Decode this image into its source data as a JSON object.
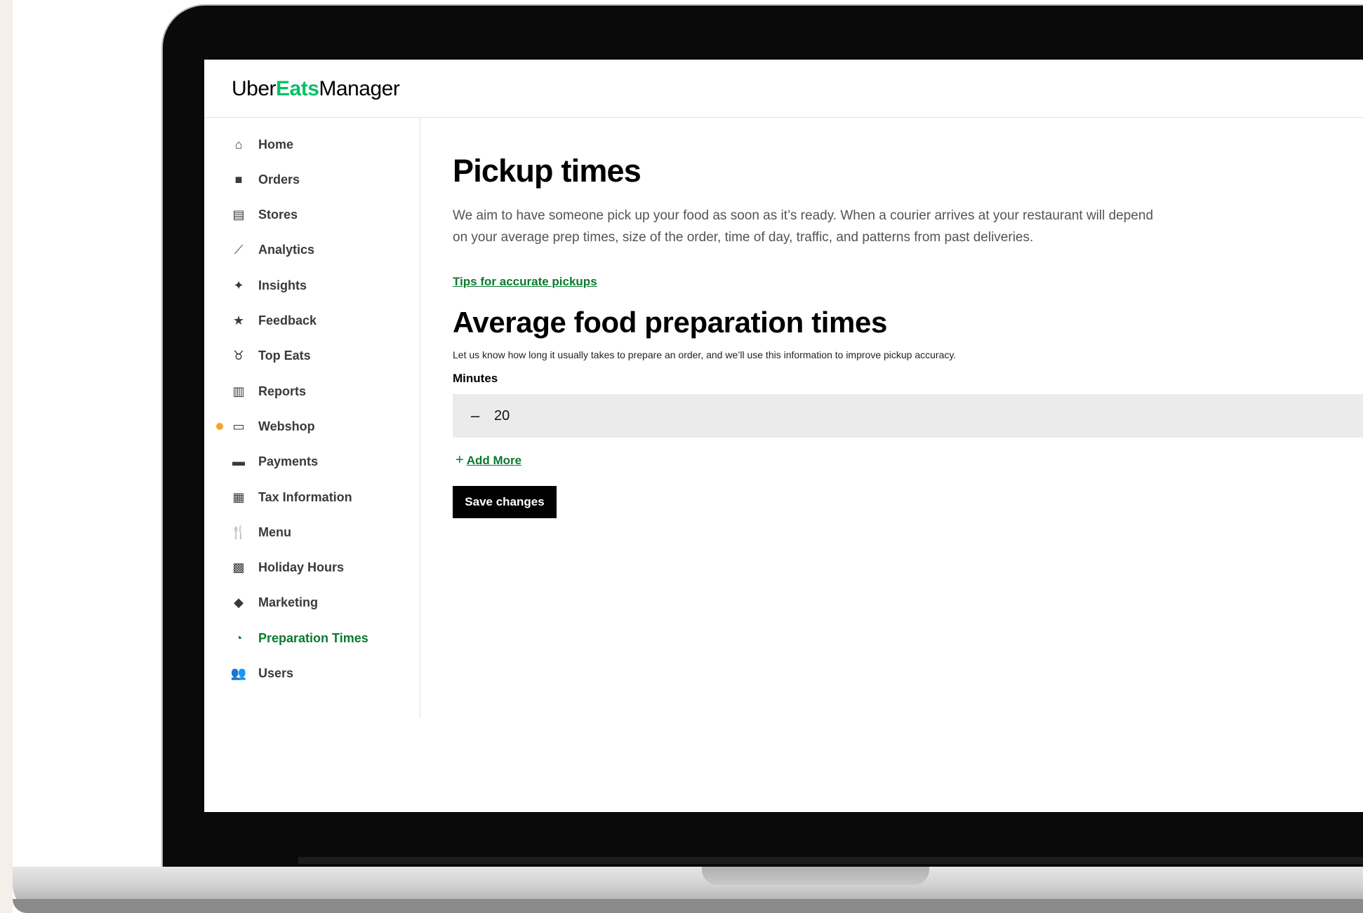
{
  "brand": {
    "part1": "Uber",
    "part2": "Eats",
    "part3": "Manager",
    "accent": "#06c167"
  },
  "sidebar": {
    "items": [
      {
        "label": "Home",
        "icon": "home-icon",
        "glyph": "⌂"
      },
      {
        "label": "Orders",
        "icon": "bag-icon",
        "glyph": "■"
      },
      {
        "label": "Stores",
        "icon": "store-icon",
        "glyph": "▤"
      },
      {
        "label": "Analytics",
        "icon": "chart-icon",
        "glyph": "⟋"
      },
      {
        "label": "Insights",
        "icon": "sparkle-icon",
        "glyph": "✦"
      },
      {
        "label": "Feedback",
        "icon": "star-icon",
        "glyph": "★"
      },
      {
        "label": "Top Eats",
        "icon": "medal-icon",
        "glyph": "♉"
      },
      {
        "label": "Reports",
        "icon": "document-icon",
        "glyph": "▥"
      },
      {
        "label": "Webshop",
        "icon": "laptop-icon",
        "glyph": "▭",
        "badge": true
      },
      {
        "label": "Payments",
        "icon": "card-icon",
        "glyph": "▬"
      },
      {
        "label": "Tax Information",
        "icon": "calculator-icon",
        "glyph": "▦"
      },
      {
        "label": "Menu",
        "icon": "utensils-icon",
        "glyph": "🍴"
      },
      {
        "label": "Holiday Hours",
        "icon": "calendar-icon",
        "glyph": "▩"
      },
      {
        "label": "Marketing",
        "icon": "tag-icon",
        "glyph": "◆"
      },
      {
        "label": "Preparation Times",
        "icon": "timer-icon",
        "glyph": "◔",
        "active": true
      },
      {
        "label": "Users",
        "icon": "users-icon",
        "glyph": "👥"
      }
    ]
  },
  "main": {
    "title": "Pickup times",
    "description": "We aim to have someone pick up your food as soon as it’s ready. When a courier arrives at your restaurant will depend on your average prep times, size of the order, time of day, traffic, and patterns from past deliveries.",
    "tips_link": "Tips for accurate pickups",
    "section_title": "Average food preparation times",
    "section_subtitle": "Let us know how long it usually takes to prepare an order, and we’ll use this information to improve pickup accuracy.",
    "minutes_label": "Minutes",
    "stepper": {
      "minus": "–",
      "value": "20"
    },
    "add_more": {
      "plus": "+",
      "label": "Add More"
    },
    "save_label": "Save changes"
  }
}
